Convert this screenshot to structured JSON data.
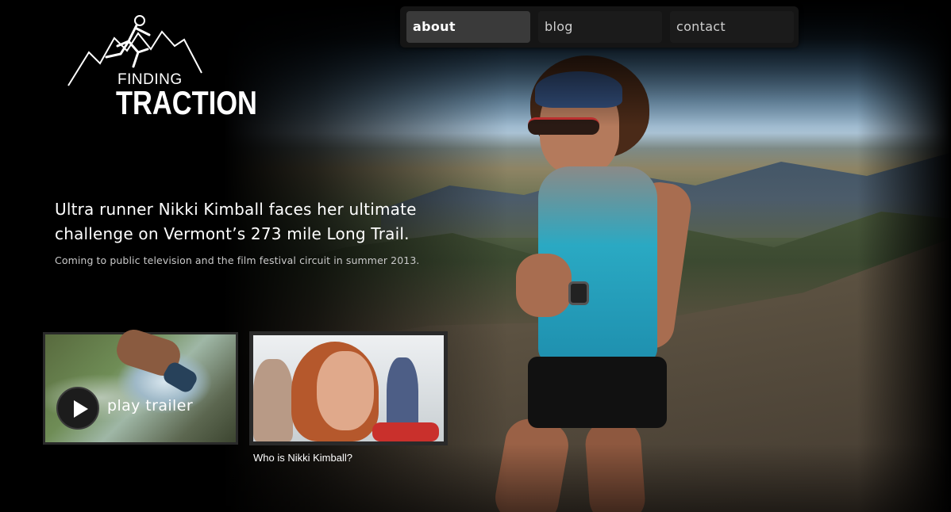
{
  "logo": {
    "line1": "FINDING",
    "line2": "TRACTION"
  },
  "nav": {
    "items": [
      {
        "label": "about",
        "active": true
      },
      {
        "label": "blog",
        "active": false
      },
      {
        "label": "contact",
        "active": false
      }
    ]
  },
  "hero": {
    "headline": "Ultra runner Nikki Kimball faces her ultimate challenge on Vermont’s 273 mile Long Trail.",
    "subline": "Coming to public television and the film festival circuit in summer 2013."
  },
  "videos": {
    "trailer_label": "play trailer",
    "profile_caption": "Who is Nikki Kimball?"
  },
  "colors": {
    "background": "#000000",
    "nav_bg": "#151515",
    "nav_active": "#3a3a3a",
    "text": "#ffffff",
    "subtext": "#c9c9c9"
  }
}
